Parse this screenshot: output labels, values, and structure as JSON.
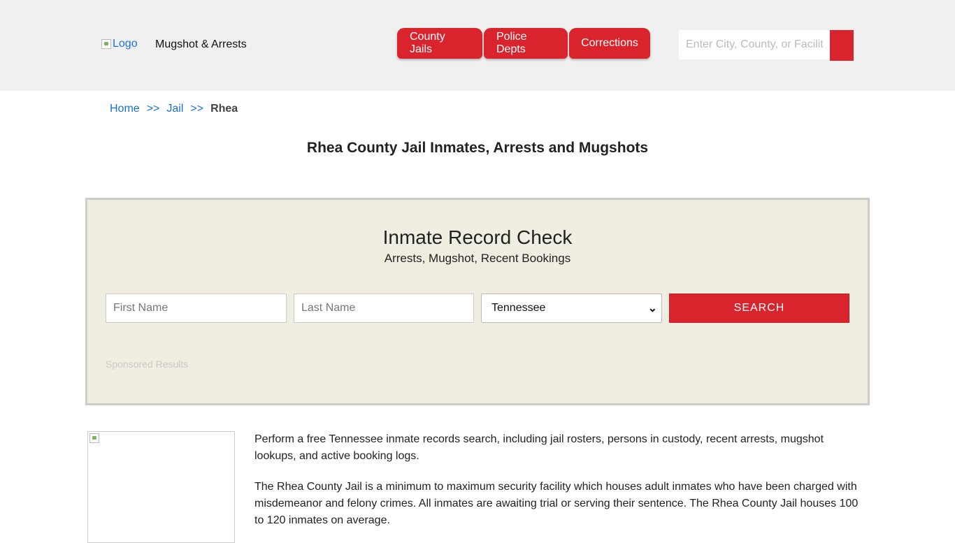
{
  "header": {
    "logo_alt": "Logo",
    "site_name": "Mugshot & Arrests",
    "nav": [
      {
        "label": "County Jails"
      },
      {
        "label": "Police Depts"
      },
      {
        "label": "Corrections"
      }
    ],
    "search_placeholder": "Enter City, County, or Facility"
  },
  "breadcrumb": {
    "home": "Home",
    "sep": ">>",
    "jail": "Jail",
    "current": "Rhea"
  },
  "page_title": "Rhea County Jail Inmates, Arrests and Mugshots",
  "record_check": {
    "title": "Inmate Record Check",
    "subtitle": "Arrests, Mugshot, Recent Bookings",
    "first_name_placeholder": "First Name",
    "last_name_placeholder": "Last Name",
    "state_selected": "Tennessee",
    "search_label": "SEARCH",
    "sponsored": "Sponsored Results"
  },
  "content": {
    "paragraphs": [
      "Perform a free Tennessee inmate records search, including jail rosters, persons in custody, recent arrests, mugshot lookups, and active booking logs.",
      "The Rhea County Jail is a minimum to maximum security facility which houses adult inmates who have been charged with misdemeanor and felony crimes. All inmates are awaiting trial or serving their sentence. The Rhea County Jail houses 100 to 120 inmates on average."
    ]
  },
  "colors": {
    "accent": "#d9232d",
    "header_bg": "#f0f0f0",
    "panel_bg": "#f0eee0",
    "link": "#1a6fd6"
  }
}
